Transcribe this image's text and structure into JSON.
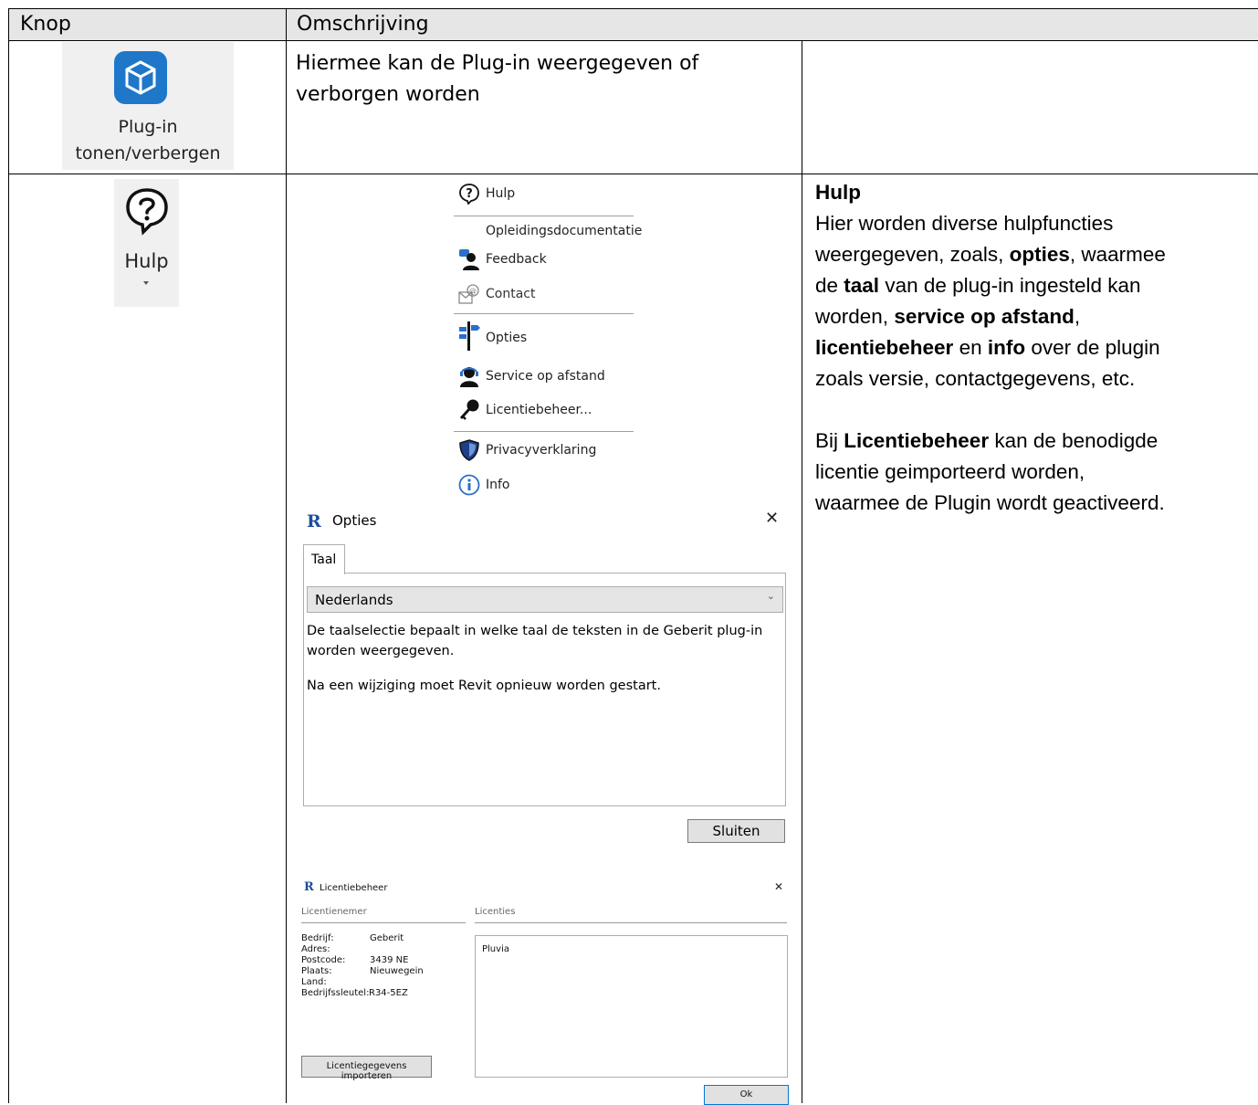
{
  "table": {
    "header": {
      "col1": "Knop",
      "col2": "Omschrijving"
    },
    "row1": {
      "button_label_line1": "Plug-in",
      "button_label_line2": "tonen/verbergen",
      "description_line1": "Hiermee kan de Plug-in weergegeven of",
      "description_line2": "verborgen worden"
    },
    "row2": {
      "button_label": "Hulp",
      "heading": "Hulp",
      "desc": {
        "l1": "Hier worden diverse hulpfuncties",
        "l2a": "weergegeven, zoals, ",
        "l2b": "opties",
        "l2c": ", waarmee",
        "l3a": "de ",
        "l3b": "taal",
        "l3c": " van de plug-in ingesteld kan",
        "l4a": "worden, ",
        "l4b": "service op afstand",
        "l4c": ",",
        "l5a": "licentiebeheer",
        "l5b": " en ",
        "l5c": "info",
        "l5d": " over de plugin",
        "l6": "zoals versie, contactgegevens, etc.",
        "l7a": "Bij ",
        "l7b": "Licentiebeheer",
        "l7c": " kan de benodigde",
        "l8": "licentie geimporteerd worden,",
        "l9": "waarmee de Plugin wordt geactiveerd."
      }
    }
  },
  "help_menu": {
    "items": [
      {
        "label": "Hulp",
        "icon": "help-circle-icon"
      },
      {
        "label": "Opleidingsdocumentatie",
        "icon": ""
      },
      {
        "label": "Feedback",
        "icon": "feedback-user-icon"
      },
      {
        "label": "Contact",
        "icon": "contact-mail-icon"
      },
      {
        "label": "Opties",
        "icon": "signpost-icon"
      },
      {
        "label": "Service op afstand",
        "icon": "headset-user-icon"
      },
      {
        "label": "Licentiebeheer...",
        "icon": "key-icon"
      },
      {
        "label": "Privacyverklaring",
        "icon": "shield-icon"
      },
      {
        "label": "Info",
        "icon": "info-circle-icon"
      }
    ]
  },
  "options_dialog": {
    "title": "Opties",
    "app_letter": "R",
    "close": "✕",
    "tab": "Taal",
    "language_selected": "Nederlands",
    "text1": "De taalselectie bepaalt in welke taal de teksten in de Geberit plug-in",
    "text2": "worden weergegeven.",
    "text3": "Na een wijziging moet Revit opnieuw worden gestart.",
    "close_button": "Sluiten"
  },
  "license_dialog": {
    "title": "Licentiebeheer",
    "app_letter": "R",
    "close": "✕",
    "licensee_header": "Licentienemer",
    "licenses_header": "Licenties",
    "fields": [
      {
        "label": "Bedrijf:",
        "value": "Geberit"
      },
      {
        "label": "Adres:",
        "value": ""
      },
      {
        "label": "Postcode:",
        "value": "3439 NE"
      },
      {
        "label": "Plaats:",
        "value": "Nieuwegein"
      },
      {
        "label": "Land:",
        "value": ""
      },
      {
        "label": "Bedrijfssleutel:",
        "value": "R34-5EZ"
      }
    ],
    "licenses": [
      "Pluvia"
    ],
    "import_button": "Licentiegegevens importeren",
    "ok_button": "Ok"
  },
  "colors": {
    "revit_blue": "#1c4f9c",
    "plugin_icon_blue": "#1f77c9",
    "header_gray": "#e7e6e6"
  }
}
